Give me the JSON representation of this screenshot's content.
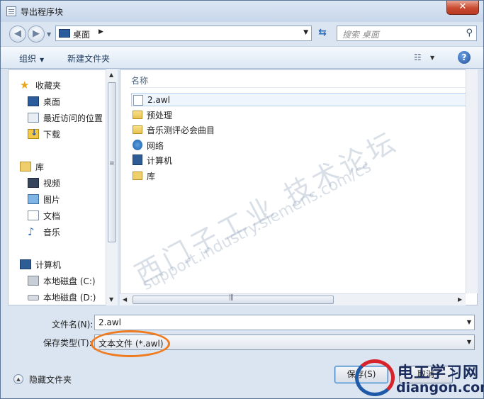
{
  "window": {
    "title": "导出程序块",
    "close_label": "✕"
  },
  "address": {
    "location": "桌面",
    "search_placeholder": "搜索 桌面"
  },
  "toolbar": {
    "organize_label": "组织",
    "new_folder_label": "新建文件夹"
  },
  "navigation": {
    "favorites": {
      "label": "收藏夹",
      "items": [
        "桌面",
        "最近访问的位置",
        "下载"
      ]
    },
    "libraries": {
      "label": "库",
      "items": [
        "视频",
        "图片",
        "文档",
        "音乐"
      ]
    },
    "computer": {
      "label": "计算机",
      "items": [
        "本地磁盘 (C:)",
        "本地磁盘 (D:)"
      ]
    }
  },
  "files": {
    "column_name": "名称",
    "items": [
      {
        "name": "2.awl",
        "icon": "file-icon",
        "selected": true
      },
      {
        "name": "预处理",
        "icon": "folder-icon"
      },
      {
        "name": "音乐测评必会曲目",
        "icon": "folder-icon"
      },
      {
        "name": "网络",
        "icon": "network-icon"
      },
      {
        "name": "计算机",
        "icon": "computer-icon"
      },
      {
        "name": "库",
        "icon": "library-icon"
      }
    ]
  },
  "watermark": {
    "line1": "西门子工业 技术论坛",
    "line2": "support.industry.siemens.com/cs"
  },
  "form": {
    "filename_label": "文件名(N):",
    "filename_value": "2.awl",
    "filetype_label": "保存类型(T):",
    "filetype_value": "文本文件 (*.awl)"
  },
  "footer": {
    "hide_folders_label": "隐藏文件夹",
    "save_label": "保存(S)",
    "cancel_label": "取消"
  },
  "logo": {
    "cn": "电工学习网",
    "en": "diangon.com"
  },
  "colors": {
    "highlight_ring": "#f07a1e",
    "accent": "#2a6ab6"
  }
}
